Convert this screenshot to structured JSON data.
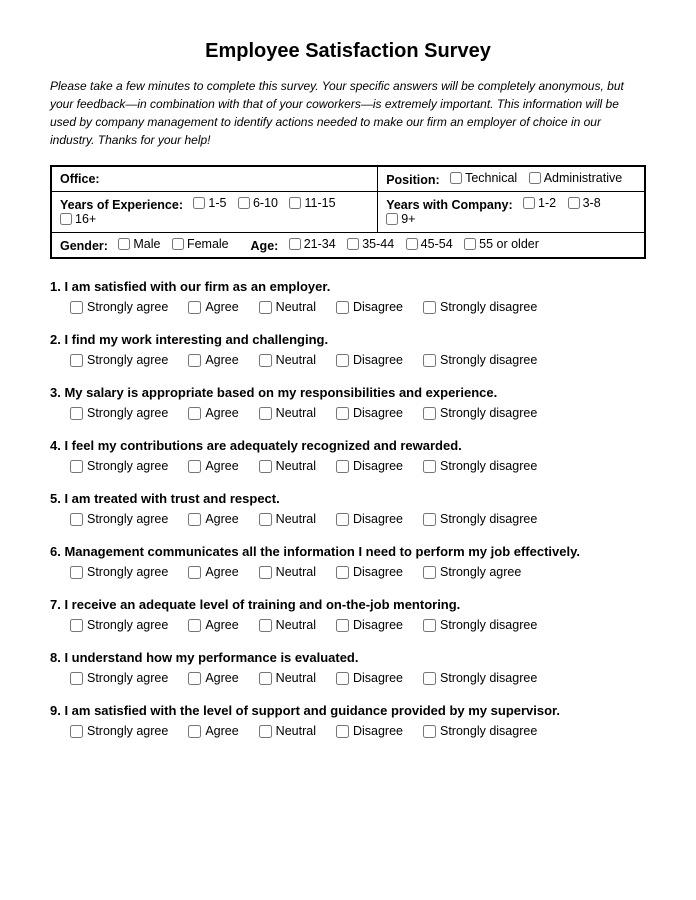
{
  "title": "Employee Satisfaction Survey",
  "intro": "Please take a few minutes to complete this survey. Your specific answers will be completely anonymous, but your feedback—in combination with that of your coworkers—is extremely important. This information will be used by company management to identify actions needed to make our firm an employer of choice in our industry. Thanks for your help!",
  "demographics": {
    "office_label": "Office:",
    "position_label": "Position:",
    "position_options": [
      "Technical",
      "Administrative"
    ],
    "years_exp_label": "Years of Experience:",
    "years_exp_options": [
      "1-5",
      "6-10",
      "11-15",
      "16+"
    ],
    "years_company_label": "Years with Company:",
    "years_company_options": [
      "1-2",
      "3-8",
      "9+"
    ],
    "gender_label": "Gender:",
    "gender_options": [
      "Male",
      "Female"
    ],
    "age_label": "Age:",
    "age_options": [
      "21-34",
      "35-44",
      "45-54",
      "55 or older"
    ]
  },
  "scale": [
    "Strongly agree",
    "Agree",
    "Neutral",
    "Disagree",
    "Strongly disagree"
  ],
  "scale_q6": [
    "Strongly agree",
    "Agree",
    "Neutral",
    "Disagree",
    "Strongly agree"
  ],
  "questions": [
    {
      "num": "1",
      "text": "I am satisfied with our firm as an employer."
    },
    {
      "num": "2",
      "text": "I find my work interesting and challenging."
    },
    {
      "num": "3",
      "text": "My salary is appropriate based on my responsibilities and experience."
    },
    {
      "num": "4",
      "text": "I feel my contributions are adequately recognized and rewarded."
    },
    {
      "num": "5",
      "text": "I am treated with trust and respect."
    },
    {
      "num": "6",
      "text": "Management communicates all the information I need to perform my job effectively.",
      "special_scale": true
    },
    {
      "num": "7",
      "text": " I receive an adequate level of training and on-the-job mentoring."
    },
    {
      "num": "8",
      "text": "I understand how my performance is evaluated."
    },
    {
      "num": "9",
      "text": "I am satisfied with the level of support and guidance provided by my supervisor."
    }
  ]
}
